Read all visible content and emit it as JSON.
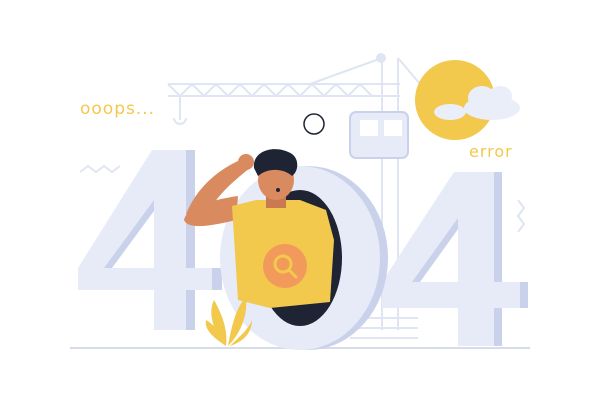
{
  "illustration": {
    "ooops_text": "ooops...",
    "error_text": "error",
    "left_digit": "4",
    "middle_digit": "0",
    "right_digit": "4"
  },
  "colors": {
    "digit_fill": "#e6ebf7",
    "digit_shadow": "#c9d2ea",
    "accent_yellow": "#f2c94c",
    "skin": "#d98a5f",
    "hair": "#1e2433",
    "crane": "#dfe5f2"
  },
  "icons": {
    "shirt_logo": "magnifier-icon",
    "sun": "sun-icon",
    "cloud": "cloud-icon",
    "plant": "plant-icon",
    "crane": "crane-icon"
  }
}
